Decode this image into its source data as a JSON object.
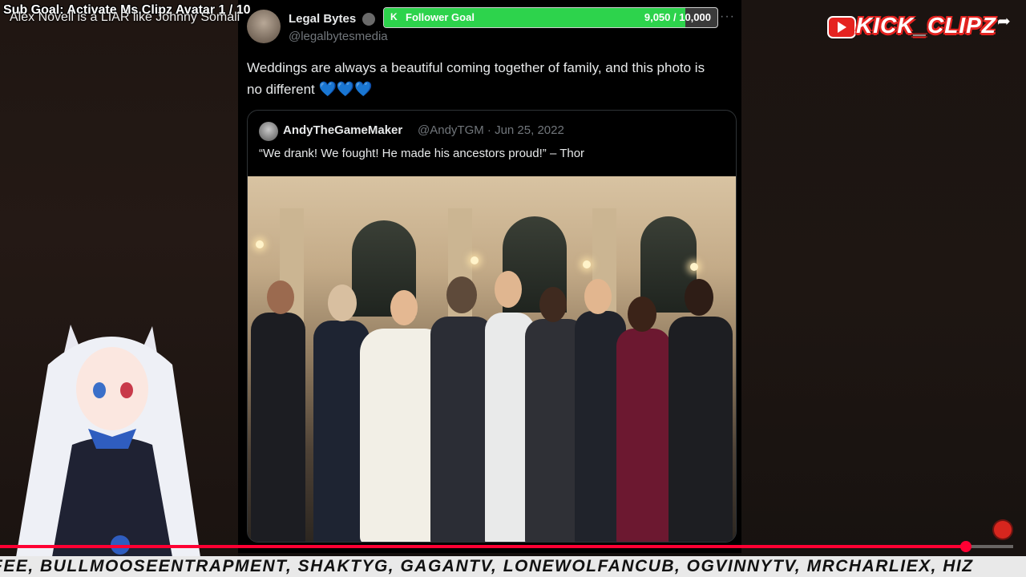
{
  "stream": {
    "sub_goal": "Sub Goal: Activate Ms.Clipz Avatar  1 / 10",
    "video_title": "Alex Novell is a LIAR like Johnny Somali",
    "brand": "KICK_CLIPZ",
    "follower_goal": {
      "label": "Follower Goal",
      "count": "9,050 / 10,000",
      "fraction": 0.905
    },
    "ticker": "FEE, BULLMOOSEENTRAPMENT, SHAKTYG, GAGANTV, LONEWOLFANCUB, OGVINNYTV, MRCHARLIEX, HIZ",
    "playback_progress": 0.953
  },
  "tweet": {
    "author": "Legal Bytes",
    "handle": "@legalbytesmedia",
    "more": "···",
    "text": "Weddings are always a beautiful coming together of family, and this photo is no different",
    "emoji": "💙💙💙",
    "quote": {
      "author": "AndyTheGameMaker",
      "handle_date": "@AndyTGM · Jun 25, 2022",
      "text": "“We drank! We fought! He made his ancestors proud!” – Thor"
    }
  },
  "icons": {
    "verified": "verified-badge-icon",
    "share": "share-arrow-icon",
    "goal": "kick-logo-icon",
    "youtube": "youtube-logo-icon",
    "subscribe": "subscribe-icon"
  }
}
